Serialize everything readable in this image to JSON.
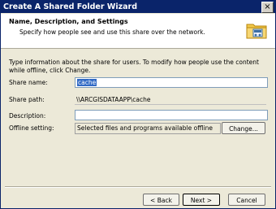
{
  "window": {
    "title": "Create A Shared Folder Wizard",
    "close_glyph": "×"
  },
  "header": {
    "title": "Name, Description, and Settings",
    "subtitle": "Specify how people see and use this share over the network."
  },
  "intro": "Type information about the share for users. To modify how people use the content while offline, click Change.",
  "form": {
    "share_name_label": "Share name:",
    "share_name_value": "cache",
    "share_path_label": "Share path:",
    "share_path_value": "\\\\ARCGISDATAAPP\\cache",
    "description_label": "Description:",
    "description_value": "",
    "offline_label": "Offline setting:",
    "offline_value": "Selected files and programs available offline",
    "change_button": "Change..."
  },
  "footer": {
    "back": "< Back",
    "next": "Next >",
    "cancel": "Cancel"
  },
  "icon": "shared-folder-icon"
}
